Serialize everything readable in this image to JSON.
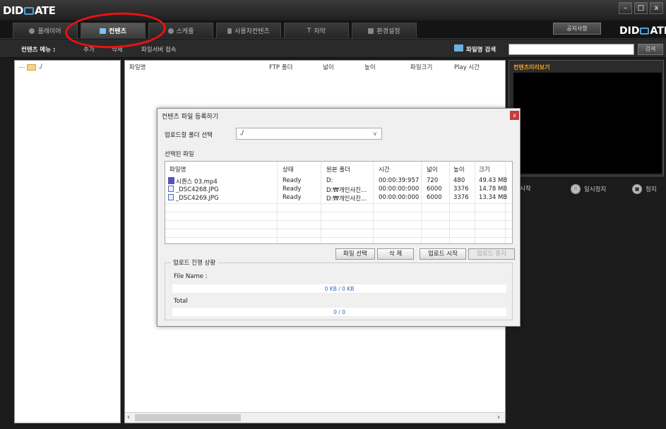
{
  "app": {
    "logo": "DIDIMATE",
    "logo_left": "DID",
    "logo_right": "ATE"
  },
  "window_controls": {
    "minimize": "–",
    "maximize": "□",
    "close": "x"
  },
  "tabs": [
    {
      "label": "플레이어",
      "icon": "circle-icon"
    },
    {
      "label": "컨텐츠",
      "icon": "content-icon",
      "active": true
    },
    {
      "label": "스케쥴",
      "icon": "circle-icon"
    },
    {
      "label": "사용자컨텐츠",
      "icon": "user-icon"
    },
    {
      "label": "자막",
      "icon": "text-icon",
      "prefix": "T"
    },
    {
      "label": "환경설정",
      "icon": "settings-icon"
    }
  ],
  "notice_button": "공지사항",
  "menu": {
    "label": "컨텐츠 메뉴 :",
    "items": [
      "추가",
      "삭제",
      "파일서버 접속"
    ],
    "file_search_label": "파일명 검색",
    "search_button": "검색"
  },
  "tree": {
    "root": "./"
  },
  "list": {
    "headers": [
      "파일명",
      "FTP 폴더",
      "넓이",
      "높이",
      "파일크기",
      "Play 시간"
    ]
  },
  "preview": {
    "title": "컨텐츠미리보기"
  },
  "controls": {
    "play": "시작",
    "pause": "일시정지",
    "stop": "정지"
  },
  "dialog": {
    "title": "컨텐츠 파일 등록하기",
    "close": "x",
    "folder_label": "업로드할 폴더 선택",
    "folder_value": "./",
    "selected_label": "선택된 파일",
    "columns": [
      "파일명",
      "상태",
      "원본 폴더",
      "시간",
      "넓이",
      "높이",
      "크기"
    ],
    "files": [
      {
        "name": "시퀀스 03.mp4",
        "type": "video",
        "status": "Ready",
        "source": "D:",
        "time": "00:00:39:957",
        "width": "720",
        "height": "480",
        "size": "49.43 MB"
      },
      {
        "name": "_DSC4268.JPG",
        "type": "image",
        "status": "Ready",
        "source": "D:₩개인사진...",
        "time": "00:00:00:000",
        "width": "6000",
        "height": "3376",
        "size": "14.78 MB"
      },
      {
        "name": "_DSC4269.JPG",
        "type": "image",
        "status": "Ready",
        "source": "D:₩개인사진...",
        "time": "00:00:00:000",
        "width": "6000",
        "height": "3376",
        "size": "13.34 MB"
      }
    ],
    "buttons": {
      "select": "파일 선택",
      "delete": "삭 제",
      "upload_start": "업로드 시작",
      "upload_stop": "업로드 중지"
    },
    "progress": {
      "legend": "업로드 진행 상황",
      "file_name_label": "File Name :",
      "file_progress": "0 KB / 0 KB",
      "total_label": "Total",
      "total_progress": "0 / 0"
    }
  },
  "colors": {
    "accent": "#4aa3df",
    "preview_title": "#f0a020",
    "annotation": "#e11111"
  }
}
